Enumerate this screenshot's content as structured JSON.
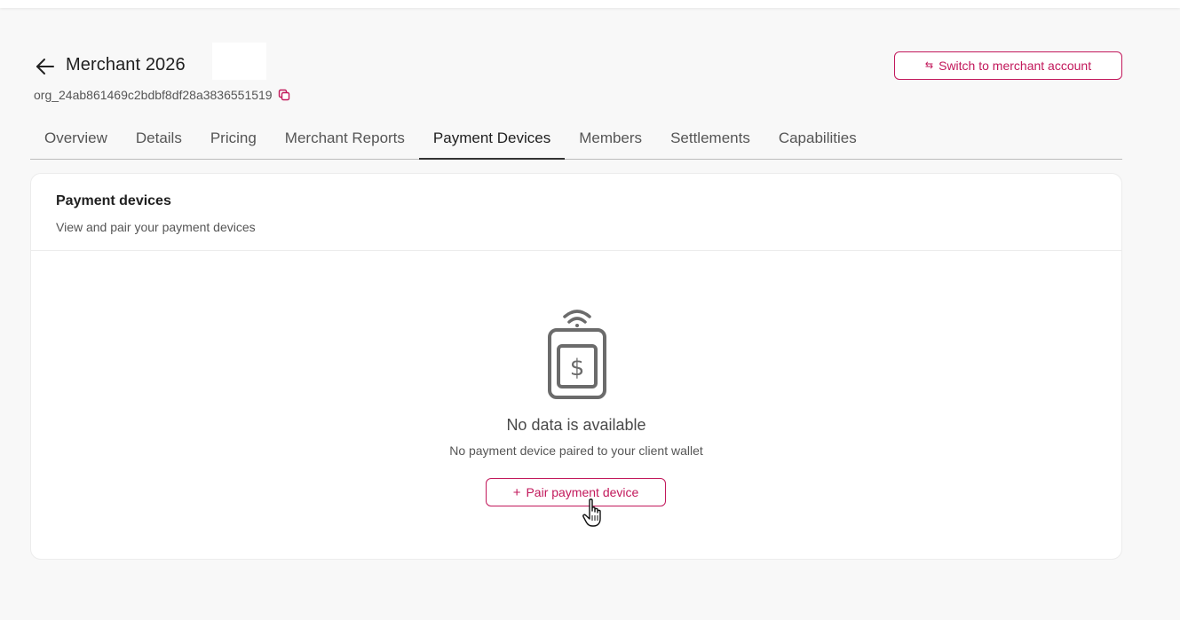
{
  "header": {
    "title": "Merchant 2026",
    "org_id": "org_24ab861469c2bdbf8df28a3836551519",
    "switch_button": "Switch to merchant account"
  },
  "tabs": [
    {
      "label": "Overview",
      "active": false
    },
    {
      "label": "Details",
      "active": false
    },
    {
      "label": "Pricing",
      "active": false
    },
    {
      "label": "Merchant Reports",
      "active": false
    },
    {
      "label": "Payment Devices",
      "active": true
    },
    {
      "label": "Members",
      "active": false
    },
    {
      "label": "Settlements",
      "active": false
    },
    {
      "label": "Capabilities",
      "active": false
    }
  ],
  "card": {
    "title": "Payment devices",
    "subtitle": "View and pair your payment devices",
    "empty_title": "No data is available",
    "empty_text": "No payment device paired to your client wallet",
    "pair_button": "Pair payment device"
  },
  "icons": {
    "back": "arrow-left-icon",
    "copy": "copy-icon",
    "switch": "switch-arrows-icon",
    "device": "payment-terminal-icon",
    "plus": "plus-icon",
    "cursor": "hand-pointer-icon"
  },
  "colors": {
    "accent": "#c2185b",
    "background": "#f8f8f8",
    "card": "#ffffff"
  }
}
